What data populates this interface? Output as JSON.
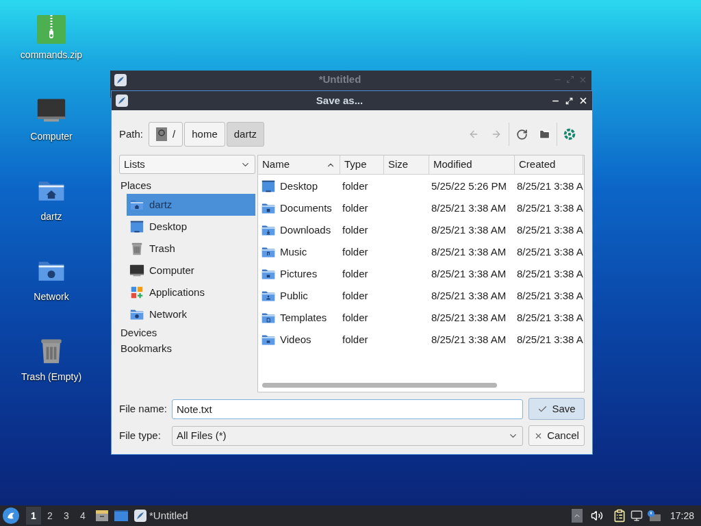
{
  "desktop_icons": [
    {
      "label": "commands.zip",
      "kind": "zip"
    },
    {
      "label": "Computer",
      "kind": "computer"
    },
    {
      "label": "dartz",
      "kind": "home"
    },
    {
      "label": "Network",
      "kind": "network"
    },
    {
      "label": "Trash (Empty)",
      "kind": "trash"
    }
  ],
  "background_window": {
    "title": "*Untitled"
  },
  "dialog": {
    "title": "Save as...",
    "path_label": "Path:",
    "path": [
      {
        "label": "/",
        "kind": "root",
        "selected": false
      },
      {
        "label": "home",
        "kind": "dir",
        "selected": false
      },
      {
        "label": "dartz",
        "kind": "dir",
        "selected": true
      }
    ],
    "toolbar": [
      {
        "kind": "back",
        "disabled": true
      },
      {
        "kind": "forward",
        "disabled": true
      },
      {
        "kind": "separator"
      },
      {
        "kind": "reload"
      },
      {
        "kind": "new-folder"
      },
      {
        "kind": "separator"
      },
      {
        "kind": "emblem"
      }
    ],
    "view_mode": "Lists",
    "sidebar": [
      {
        "label": "Places",
        "items": [
          {
            "label": "dartz",
            "kind": "home",
            "selected": true
          },
          {
            "label": "Desktop",
            "kind": "desktop",
            "selected": false
          },
          {
            "label": "Trash",
            "kind": "trash",
            "selected": false
          },
          {
            "label": "Computer",
            "kind": "computer",
            "selected": false
          },
          {
            "label": "Applications",
            "kind": "apps",
            "selected": false
          },
          {
            "label": "Network",
            "kind": "network",
            "selected": false
          }
        ]
      },
      {
        "label": "Devices"
      },
      {
        "label": "Bookmarks"
      }
    ],
    "columns": [
      {
        "label": "Name",
        "sorted": true
      },
      {
        "label": "Type",
        "sorted": false
      },
      {
        "label": "Size",
        "sorted": false
      },
      {
        "label": "Modified",
        "sorted": false
      },
      {
        "label": "Created",
        "sorted": false
      }
    ],
    "rows": [
      {
        "name": "Desktop",
        "kind": "desktop",
        "type": "folder",
        "modified": "5/25/22 5:26 PM",
        "created": "8/25/21 3:38 A"
      },
      {
        "name": "Documents",
        "kind": "documents",
        "type": "folder",
        "modified": "8/25/21 3:38 AM",
        "created": "8/25/21 3:38 A"
      },
      {
        "name": "Downloads",
        "kind": "downloads",
        "type": "folder",
        "modified": "8/25/21 3:38 AM",
        "created": "8/25/21 3:38 A"
      },
      {
        "name": "Music",
        "kind": "music",
        "type": "folder",
        "modified": "8/25/21 3:38 AM",
        "created": "8/25/21 3:38 A"
      },
      {
        "name": "Pictures",
        "kind": "pictures",
        "type": "folder",
        "modified": "8/25/21 3:38 AM",
        "created": "8/25/21 3:38 A"
      },
      {
        "name": "Public",
        "kind": "public",
        "type": "folder",
        "modified": "8/25/21 3:38 AM",
        "created": "8/25/21 3:38 A"
      },
      {
        "name": "Templates",
        "kind": "templates",
        "type": "folder",
        "modified": "8/25/21 3:38 AM",
        "created": "8/25/21 3:38 A"
      },
      {
        "name": "Videos",
        "kind": "videos",
        "type": "folder",
        "modified": "8/25/21 3:38 AM",
        "created": "8/25/21 3:38 A"
      }
    ],
    "file_name_label": "File name:",
    "file_name": "Note.txt",
    "file_type_label": "File type:",
    "file_type": "All Files (*)",
    "save_button": "Save",
    "cancel_button": "Cancel"
  },
  "taskbar": {
    "workspaces": [
      {
        "label": "1",
        "selected": true
      },
      {
        "label": "2",
        "selected": false
      },
      {
        "label": "3",
        "selected": false
      },
      {
        "label": "4",
        "selected": false
      }
    ],
    "window_button": "*Untitled",
    "clock": "17:28"
  }
}
